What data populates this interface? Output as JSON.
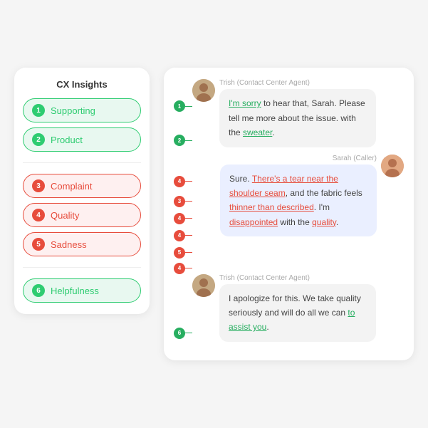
{
  "leftPanel": {
    "title": "CX Insights",
    "tags": [
      {
        "id": 1,
        "label": "Supporting",
        "color": "green"
      },
      {
        "id": 2,
        "label": "Product",
        "color": "green"
      },
      {
        "id": 3,
        "label": "Complaint",
        "color": "red"
      },
      {
        "id": 4,
        "label": "Quality",
        "color": "red"
      },
      {
        "id": 5,
        "label": "Sadness",
        "color": "red"
      },
      {
        "id": 6,
        "label": "Helpfulness",
        "color": "green"
      }
    ]
  },
  "chat": {
    "messages": [
      {
        "id": "msg1",
        "from": "agent",
        "name": "Trish (Contact Center Agent)",
        "text_parts": [
          {
            "text": "I'm sorry",
            "style": "underline-green"
          },
          {
            "text": " to hear that, Sarah. Please tell me more about the issue. with the "
          },
          {
            "text": "sweater",
            "style": "underline-green"
          },
          {
            "text": "."
          }
        ],
        "annotations": [
          {
            "num": 1,
            "color": "green",
            "line_pct": 0
          },
          {
            "num": 2,
            "color": "green",
            "line_pct": 60
          }
        ]
      },
      {
        "id": "msg2",
        "from": "caller",
        "name": "Sarah (Caller)",
        "text_parts": [
          {
            "text": "Sure. "
          },
          {
            "text": "There's a tear near the shoulder seam",
            "style": "underline-red"
          },
          {
            "text": ", and the fabric feels "
          },
          {
            "text": "thinner than described",
            "style": "underline-red"
          },
          {
            "text": ". I'm "
          },
          {
            "text": "disappointed",
            "style": "underline-red"
          },
          {
            "text": " with the "
          },
          {
            "text": "quality",
            "style": "underline-red"
          },
          {
            "text": "."
          }
        ],
        "annotations": [
          {
            "num": 4,
            "color": "red",
            "line_pct": 0
          },
          {
            "num": 3,
            "color": "red",
            "line_pct": 25
          },
          {
            "num": 4,
            "color": "red",
            "line_pct": 45
          },
          {
            "num": 4,
            "color": "red",
            "line_pct": 63
          },
          {
            "num": 5,
            "color": "red",
            "line_pct": 75
          },
          {
            "num": 4,
            "color": "red",
            "line_pct": 88
          }
        ]
      },
      {
        "id": "msg3",
        "from": "agent",
        "name": "Trish (Contact Center Agent)",
        "text_parts": [
          {
            "text": "I apologize for this. We take quality seriously and will do all we can "
          },
          {
            "text": "to assist you",
            "style": "underline-green"
          },
          {
            "text": "."
          }
        ],
        "annotations": [
          {
            "num": 6,
            "color": "green",
            "line_pct": 85
          }
        ]
      }
    ]
  }
}
